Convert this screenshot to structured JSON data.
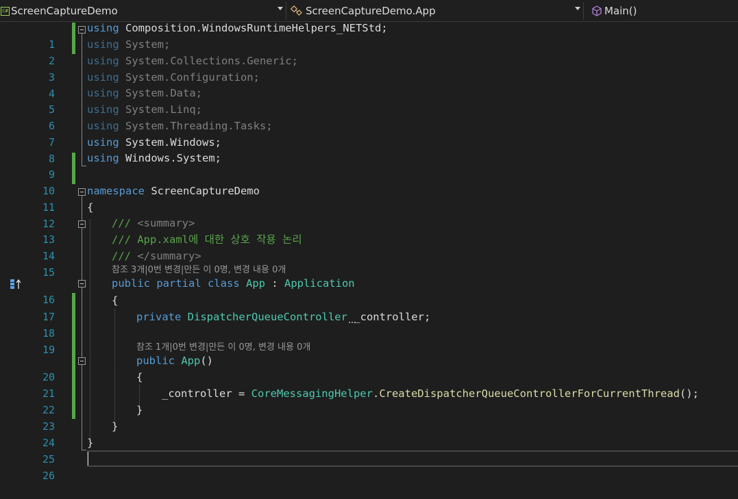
{
  "navbar": {
    "project": "ScreenCaptureDemo",
    "project_icon": "csharp-project-icon",
    "type": "ScreenCaptureDemo.App",
    "type_icon": "class-icon",
    "member": "Main()",
    "member_icon": "method-cube-icon"
  },
  "line_numbers": [
    "1",
    "2",
    "3",
    "4",
    "5",
    "6",
    "7",
    "8",
    "9",
    "10",
    "11",
    "12",
    "13",
    "14",
    "15",
    "16",
    "17",
    "18",
    "19",
    "20",
    "21",
    "22",
    "23",
    "24",
    "25",
    "26"
  ],
  "code": {
    "l1": {
      "kw": "using",
      "rest": " Composition.WindowsRuntimeHelpers_NETStd;"
    },
    "l2": {
      "kw": "using",
      "rest": " System;"
    },
    "l3": {
      "kw": "using",
      "rest": " System.Collections.Generic;"
    },
    "l4": {
      "kw": "using",
      "rest": " System.Configuration;"
    },
    "l5": {
      "kw": "using",
      "rest": " System.Data;"
    },
    "l6": {
      "kw": "using",
      "rest": " System.Linq;"
    },
    "l7": {
      "kw": "using",
      "rest": " System.Threading.Tasks;"
    },
    "l8": {
      "kw": "using",
      "rest": " System.Windows;"
    },
    "l9": {
      "kw": "using",
      "rest": " Windows.System;"
    },
    "l11": {
      "kw": "namespace",
      "rest": " ScreenCaptureDemo"
    },
    "l12": "{",
    "l13": {
      "prefix": "/// ",
      "tag": "<summary>"
    },
    "l14": "/// App.xaml에 대한 상호 작용 논리",
    "l15": {
      "prefix": "/// ",
      "tag": "</summary>"
    },
    "lens1": "참조 3개|0번 변경|만든 이 0명, 변경 내용 0개",
    "l16": {
      "kw": "public partial class",
      "type": "App",
      "sep": " : ",
      "base": "Application"
    },
    "l17": "{",
    "l18": {
      "kw": "private",
      "type": "DispatcherQueueController",
      "field_start": " _",
      "field_rest": "controller;"
    },
    "lens2": "참조 1개|0번 변경|만든 이 0명, 변경 내용 0개",
    "l20": {
      "kw": "public",
      "method": "App",
      "rest": "()"
    },
    "l21": "{",
    "l22": {
      "field": "_controller",
      "op": " = ",
      "type": "CoreMessagingHelper",
      "dot": ".",
      "method": "CreateDispatcherQueueControllerForCurrentThread",
      "rest": "();"
    },
    "l23": "}",
    "l24": "}",
    "l25": "}"
  },
  "colors": {
    "keyword": "#569cd6",
    "type": "#4ec9b0",
    "method": "#dcdcaa",
    "comment": "#57a64a",
    "line_number": "#2b91af",
    "change_bar": "#57a64a"
  }
}
